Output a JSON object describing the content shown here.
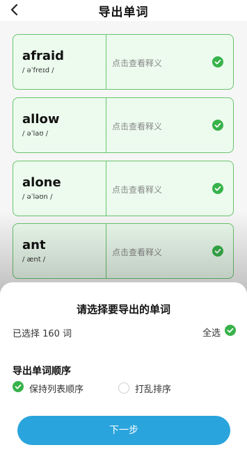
{
  "header": {
    "title": "导出单词"
  },
  "words": [
    {
      "word": "afraid",
      "phonetic": "/ əˈfreɪd /",
      "hint": "点击查看释义"
    },
    {
      "word": "allow",
      "phonetic": "/ əˈlaʊ /",
      "hint": "点击查看释义"
    },
    {
      "word": "alone",
      "phonetic": "/ əˈləʊn /",
      "hint": "点击查看释义"
    },
    {
      "word": "ant",
      "phonetic": "/ ænt /",
      "hint": "点击查看释义"
    }
  ],
  "sheet": {
    "title": "请选择要导出的单词",
    "selected_count": "已选择 160 词",
    "select_all": "全选",
    "order_title": "导出单词顺序",
    "option_keep": "保持列表顺序",
    "option_shuffle": "打乱排序",
    "next": "下一步"
  },
  "colors": {
    "accent_green": "#38b24a",
    "button_blue": "#2aa4dc",
    "card_bg": "#ecfbee"
  }
}
